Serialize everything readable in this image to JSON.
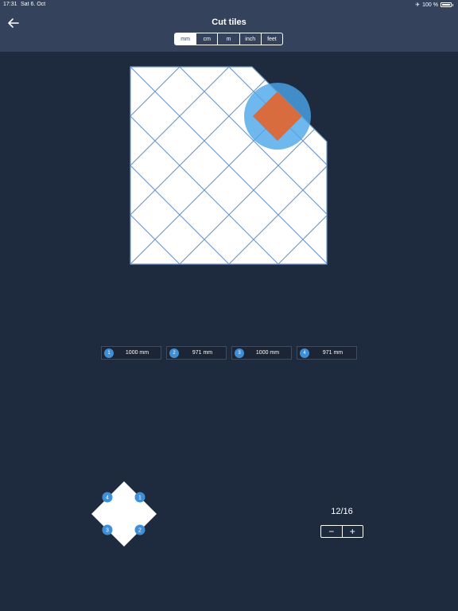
{
  "status": {
    "time": "17:31",
    "date": "Sat 6. Oct",
    "battery": "100 %"
  },
  "header": {
    "title": "Cut tiles"
  },
  "units": {
    "options": [
      "mm",
      "cm",
      "m",
      "inch",
      "feet"
    ],
    "selected": "mm"
  },
  "measurements": [
    {
      "badge": "1",
      "value": "1000 mm"
    },
    {
      "badge": "2",
      "value": "971 mm"
    },
    {
      "badge": "3",
      "value": "1000 mm"
    },
    {
      "badge": "4",
      "value": "971 mm"
    }
  ],
  "tile_corners": [
    "1",
    "2",
    "3",
    "4"
  ],
  "pager": {
    "label": "12/16",
    "minus": "−",
    "plus": "+"
  },
  "colors": {
    "background": "#1e2a3e",
    "header": "#34435b",
    "cut_tile_fill": "#e3e0aa",
    "tile_fill": "#ffffff",
    "grout": "#6f97c9",
    "selection_circle": "#4ba6ea",
    "selected_tile": "#d86c3f",
    "badge": "#3f8fd6"
  }
}
